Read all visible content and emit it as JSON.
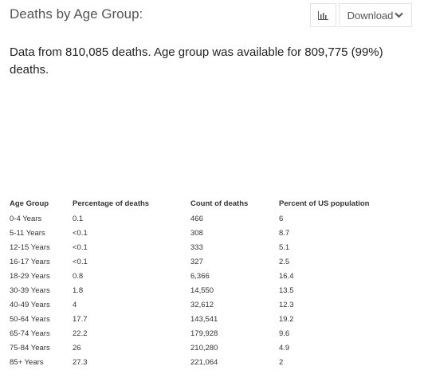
{
  "header": {
    "title": "Deaths by Age Group:"
  },
  "toolbar": {
    "chart_icon": "bar-chart-icon",
    "download_label": "Download",
    "download_icon": "chevron-down-icon"
  },
  "summary": {
    "text": "Data from 810,085 deaths. Age group was available for 809,775 (99%) deaths."
  },
  "table": {
    "headers": [
      "Age Group",
      "Percentage of deaths",
      "Count of deaths",
      "Percent of US population"
    ],
    "rows": [
      [
        "0-4 Years",
        "0.1",
        "466",
        "6"
      ],
      [
        "5-11 Years",
        "<0.1",
        "308",
        "8.7"
      ],
      [
        "12-15 Years",
        "<0.1",
        "333",
        "5.1"
      ],
      [
        "16-17 Years",
        "<0.1",
        "327",
        "2.5"
      ],
      [
        "18-29 Years",
        "0.8",
        "6,366",
        "16.4"
      ],
      [
        "30-39 Years",
        "1.8",
        "14,550",
        "13.5"
      ],
      [
        "40-49 Years",
        "4",
        "32,612",
        "12.3"
      ],
      [
        "50-64 Years",
        "17.7",
        "143,541",
        "19.2"
      ],
      [
        "65-74 Years",
        "22.2",
        "179,928",
        "9.6"
      ],
      [
        "75-84 Years",
        "26",
        "210,280",
        "4.9"
      ],
      [
        "85+ Years",
        "27.3",
        "221,064",
        "2"
      ]
    ]
  }
}
